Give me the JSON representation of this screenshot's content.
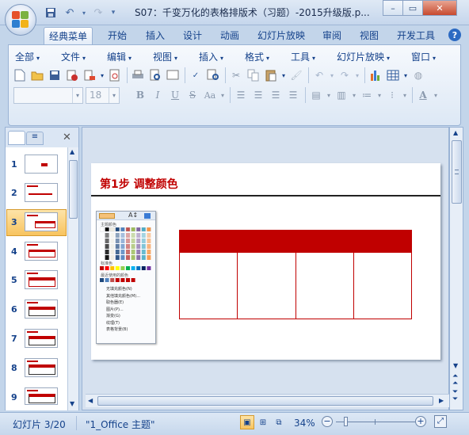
{
  "window": {
    "title": "S07：千变万化的表格排版术（习题）-2015升级版.p...",
    "controls": {
      "minimize": "–",
      "restore": "▭",
      "close": "✕"
    }
  },
  "ribbon_tabs": [
    "经典菜单",
    "开始",
    "插入",
    "设计",
    "动画",
    "幻灯片放映",
    "审阅",
    "视图",
    "开发工具"
  ],
  "active_tab": "经典菜单",
  "help_label": "?",
  "menus": [
    "全部",
    "文件",
    "编辑",
    "视图",
    "插入",
    "格式",
    "工具",
    "幻灯片放映",
    "窗口"
  ],
  "font_name_value": "",
  "font_size_value": "18",
  "thumbnail_panel": {
    "tab_icons": [
      "slides-tab-icon",
      "outline-tab-icon"
    ],
    "close_label": "✕",
    "slides": [
      "1",
      "2",
      "3",
      "4",
      "5",
      "6",
      "7",
      "8",
      "9"
    ],
    "selected": "3"
  },
  "slide": {
    "heading": "第1步  调整颜色",
    "heading_color": "#c00000",
    "table_header_color": "#c00000",
    "table_border_color": "#c00000",
    "table_columns": 4,
    "table_body_rows": 1
  },
  "palette_popup": {
    "label_theme": "主题颜色",
    "label_standard": "标准色",
    "label_recent": "最近使用的颜色",
    "items": [
      "无填充颜色(N)",
      "其他填充颜色(M)...",
      "取色器(E)",
      "图片(P)...",
      "渐变(G)",
      "纹理(T)",
      "表格背景(B)"
    ]
  },
  "status": {
    "slide_info": "幻灯片 3/20",
    "theme": "\"1_Office 主题\"",
    "zoom": "34%",
    "zoom_minus": "−",
    "zoom_plus": "+"
  }
}
